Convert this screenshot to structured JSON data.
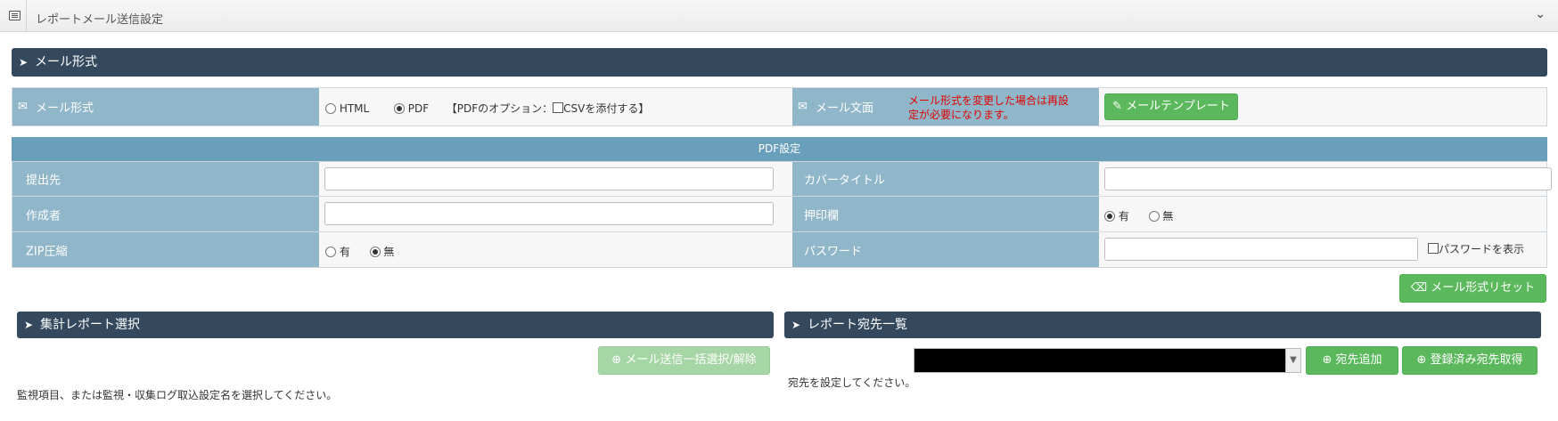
{
  "header": {
    "title": "レポートメール送信設定",
    "menu_icon": "list-icon",
    "collapse_icon": "chevron-down-icon"
  },
  "mail_format_section": {
    "title": "メール形式",
    "icon": "rocket-icon"
  },
  "mail_format_row": {
    "format_label": "メール形式",
    "html_label": "HTML",
    "pdf_label": "PDF",
    "pdf_option_prefix": "【PDFのオプション：",
    "csv_label": "CSVを添付する】",
    "body_label": "メール文面",
    "note": "メール形式を変更した場合は再設定が必要になります。",
    "template_button": "メールテンプレート"
  },
  "pdf_settings": {
    "header": "PDF設定",
    "submit_to_label": "提出先",
    "submit_to_value": "",
    "cover_title_label": "カバータイトル",
    "cover_title_value": "",
    "author_label": "作成者",
    "author_value": "",
    "stamp_label": "押印欄",
    "stamp_yes": "有",
    "stamp_no": "無",
    "zip_label": "ZIP圧縮",
    "zip_yes": "有",
    "zip_no": "無",
    "password_label": "パスワード",
    "password_value": "",
    "show_password_label": "パスワードを表示"
  },
  "reset_button": "メール形式リセット",
  "report_select_section": {
    "title": "集計レポート選択",
    "bulk_button": "メール送信一括選択/解除",
    "hint": "監視項目、または監視・収集ログ取込設定名を選択してください。"
  },
  "recipients_section": {
    "title": "レポート宛先一覧",
    "selected_value": "",
    "add_button": "宛先追加",
    "fetch_button": "登録済み宛先取得",
    "hint": "宛先を設定してください。"
  },
  "colors": {
    "section_dark": "#34495e",
    "label_blue": "#8fb6c9",
    "pdf_header": "#6a9fbb",
    "green": "#5cb85c",
    "note_red": "#e00000"
  }
}
